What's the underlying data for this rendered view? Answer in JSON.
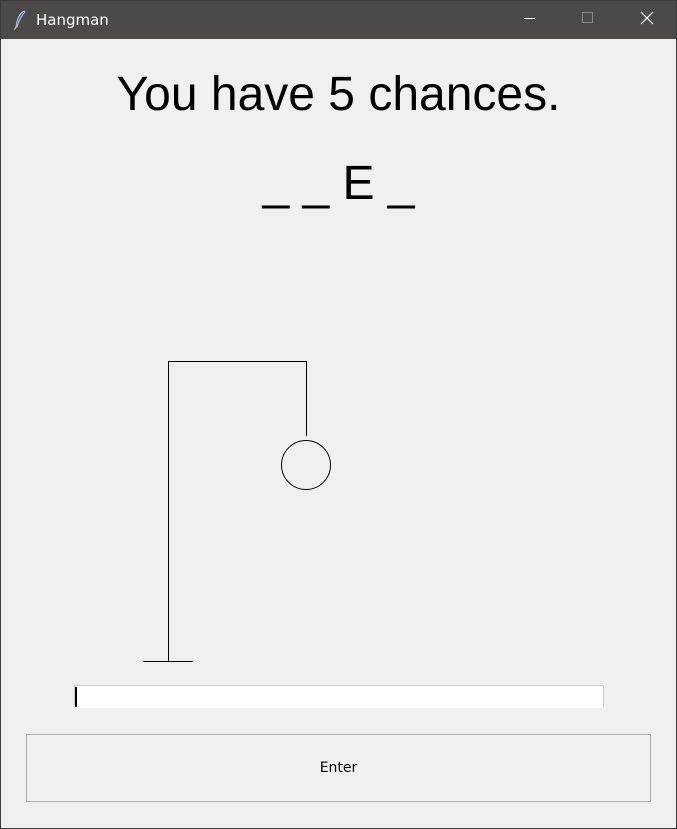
{
  "window": {
    "title": "Hangman",
    "titlebar_color": "#4b4a48",
    "background_color": "#f0f0f0"
  },
  "game": {
    "chances_text": "You have 5 chances.",
    "word_display": "_ _ E _"
  },
  "input": {
    "value": ""
  },
  "enter_button": {
    "label": "Enter"
  },
  "icons": {
    "app": "feather-icon",
    "minimize": "minimize-icon",
    "maximize": "maximize-icon",
    "close": "close-icon"
  }
}
